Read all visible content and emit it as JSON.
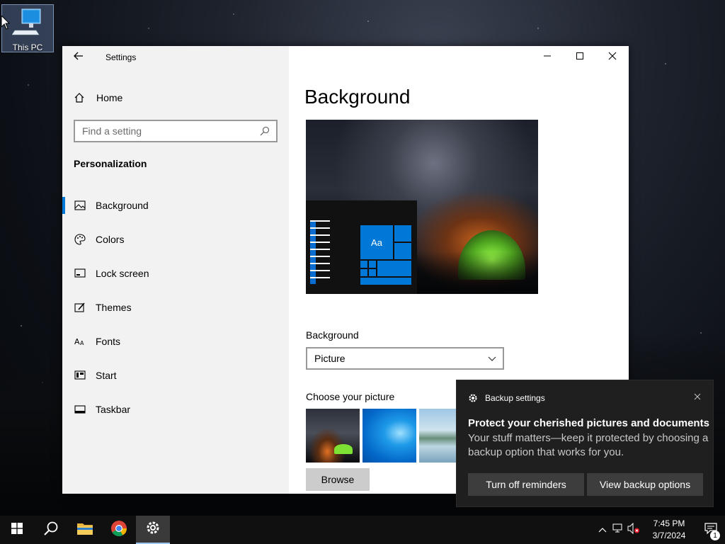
{
  "desktop": {
    "icon_label": "This PC"
  },
  "window": {
    "title": "Settings",
    "page_title": "Background"
  },
  "sidebar": {
    "home_label": "Home",
    "search_placeholder": "Find a setting",
    "section_title": "Personalization",
    "items": [
      {
        "label": "Background",
        "icon": "picture-icon",
        "active": true
      },
      {
        "label": "Colors",
        "icon": "palette-icon",
        "active": false
      },
      {
        "label": "Lock screen",
        "icon": "lock-screen-icon",
        "active": false
      },
      {
        "label": "Themes",
        "icon": "themes-icon",
        "active": false
      },
      {
        "label": "Fonts",
        "icon": "fonts-icon",
        "active": false
      },
      {
        "label": "Start",
        "icon": "start-icon",
        "active": false
      },
      {
        "label": "Taskbar",
        "icon": "taskbar-icon",
        "active": false
      }
    ]
  },
  "content": {
    "preview_tile_text": "Aa",
    "background_label": "Background",
    "background_value": "Picture",
    "choose_picture_label": "Choose your picture",
    "browse_label": "Browse"
  },
  "toast": {
    "app_name": "Backup settings",
    "title": "Protect your cherished pictures and documents",
    "body": "Your stuff matters—keep it protected by choosing a backup option that works for you.",
    "button_1": "Turn off reminders",
    "button_2": "View backup options"
  },
  "taskbar": {
    "time": "7:45 PM",
    "date": "3/7/2024",
    "notification_count": "1"
  },
  "colors": {
    "accent": "#0078d7",
    "toast_bg": "#1f1f1f",
    "taskbar_bg": "#101010"
  }
}
